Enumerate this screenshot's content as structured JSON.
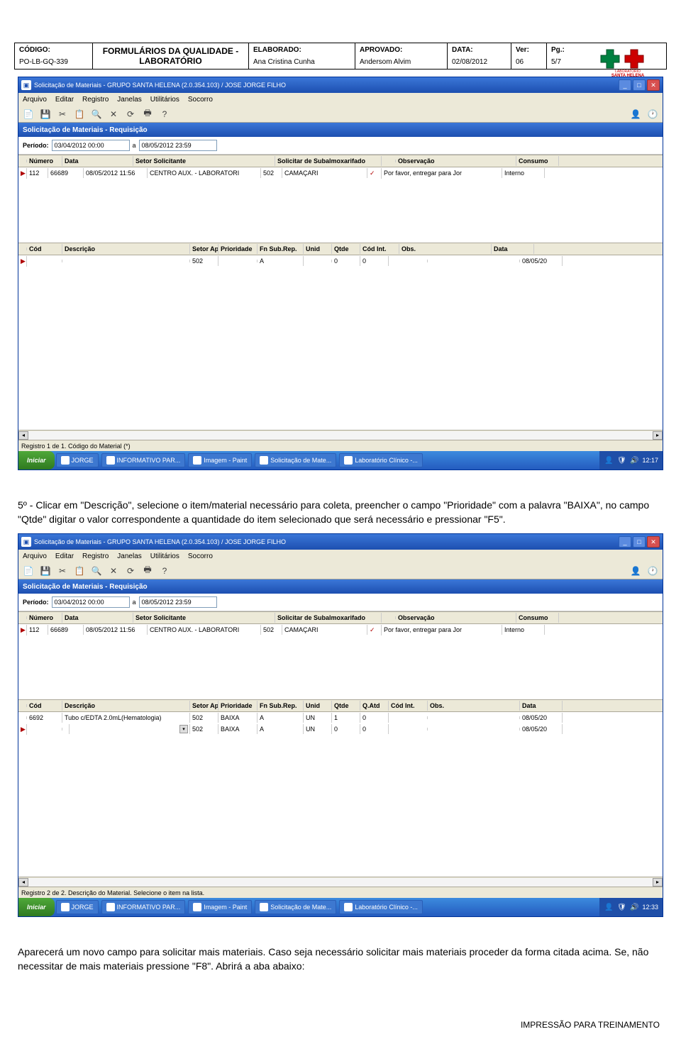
{
  "logo": {
    "line1": "LABORATÓRIO",
    "line2": "SANTA HELENA"
  },
  "doc_header": {
    "codigo_lbl": "CÓDIGO:",
    "codigo": "PO-LB-GQ-339",
    "title": "FORMULÁRIOS DA QUALIDADE - LABORATÓRIO",
    "elab_lbl": "ELABORADO:",
    "elab": "Ana Cristina Cunha",
    "aprov_lbl": "APROVADO:",
    "aprov": "Andersom Alvim",
    "data_lbl": "DATA:",
    "data": "02/08/2012",
    "ver_lbl": "Ver:",
    "ver": "06",
    "pg_lbl": "Pg.:",
    "pg": "5/7"
  },
  "para1": "5º - Clicar em \"Descrição\", selecione o item/material necessário para coleta, preencher o campo \"Prioridade\" com a palavra \"BAIXA\", no campo \"Qtde\" digitar o valor correspondente a quantidade do item selecionado que será necessário e pressionar \"F5\".",
  "para2": "Aparecerá um novo campo para solicitar mais materiais. Caso seja necessário solicitar mais materiais proceder da forma citada acima. Se, não necessitar de mais materiais pressione \"F8\". Abrirá a aba abaixo:",
  "footer": "IMPRESSÃO PARA TREINAMENTO",
  "scr": {
    "title": "Solicitação de Materiais - GRUPO SANTA HELENA (2.0.354.103) / JOSE JORGE FILHO",
    "menu": [
      "Arquivo",
      "Editar",
      "Registro",
      "Janelas",
      "Utilitários",
      "Socorro"
    ],
    "subtitle": "Solicitação de Materiais - Requisição",
    "periodo_lbl": "Período:",
    "periodo_from": "03/04/2012 00:00",
    "periodo_sep": "a",
    "periodo_to": "08/05/2012 23:59",
    "head1": [
      "Número",
      "Data",
      "Setor Solicitante",
      "Solicitar de Subalmoxarifado",
      "Observação",
      "Consumo"
    ],
    "row1": [
      "112",
      "66689",
      "08/05/2012 11:56",
      "CENTRO AUX. - LABORATORI",
      "502",
      "CAMAÇARI",
      "✓",
      "Por favor, entregar para Jor",
      "Interno"
    ],
    "head2": [
      "Cód",
      "Descrição",
      "Setor\nAplic",
      "Prioridade",
      "Fn Sub.Rep.",
      "Unid",
      "Qtde",
      "Cód Int.",
      "Obs.",
      "Data"
    ],
    "row2": [
      "",
      "",
      "502",
      "",
      "A",
      "",
      "0",
      "0",
      "",
      "",
      "08/05/20"
    ],
    "status1": "Registro 1 de 1. Código do Material (*)",
    "head2b": [
      "Cód",
      "Descrição",
      "Setor\nAplic",
      "Prioridade",
      "Fn Sub.Rep.",
      "Unid",
      "Qtde",
      "Q.Atd",
      "Cód Int.",
      "Obs.",
      "Data"
    ],
    "row2b_a": [
      "6692",
      "Tubo c/EDTA 2.0mL(Hematologia)",
      "502",
      "BAIXA",
      "A",
      "",
      "UN",
      "1",
      "0",
      "",
      "",
      "08/05/20"
    ],
    "row2b_b": [
      "",
      "",
      "502",
      "BAIXA",
      "A",
      "",
      "UN",
      "0",
      "0",
      "",
      "",
      "08/05/20"
    ],
    "status2": "Registro 2 de 2. Descrição do Material. Selecione o item na lista.",
    "taskbar": {
      "start": "Iniciar",
      "items": [
        "JORGE",
        "INFORMATIVO PAR...",
        "Imagem - Paint",
        "Solicitação de Mate...",
        "Laboratório Clínico -..."
      ],
      "time1": "12:17",
      "time2": "12:33"
    }
  }
}
